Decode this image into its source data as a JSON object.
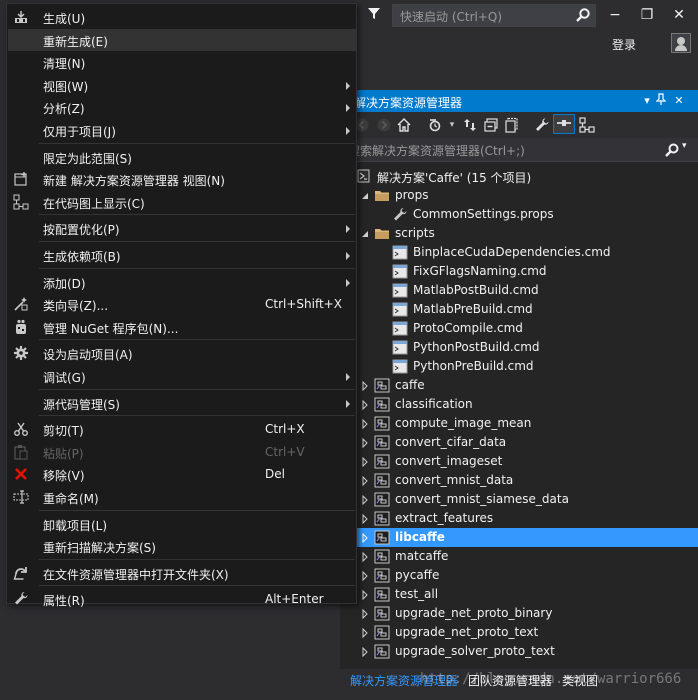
{
  "quick_launch": {
    "placeholder": "快速启动 (Ctrl+Q)"
  },
  "account": {
    "login_label": "登录"
  },
  "window_buttons": {
    "minimize": "−",
    "restore": "❐",
    "close": "✕"
  },
  "solution_explorer": {
    "title": "解决方案资源管理器",
    "search_placeholder": "搜索解决方案资源管理器(Ctrl+;)",
    "tree": [
      {
        "label": "解决方案'Caffe' (15 个项目)",
        "icon": "solution-icon",
        "level": 0,
        "expanded": true
      },
      {
        "label": "props",
        "icon": "folder-icon",
        "level": 1,
        "expanded": true
      },
      {
        "label": "CommonSettings.props",
        "icon": "wrench-icon",
        "level": 2
      },
      {
        "label": "scripts",
        "icon": "folder-icon",
        "level": 1,
        "expanded": true
      },
      {
        "label": "BinplaceCudaDependencies.cmd",
        "icon": "cmd-file-icon",
        "level": 2
      },
      {
        "label": "FixGFlagsNaming.cmd",
        "icon": "cmd-file-icon",
        "level": 2
      },
      {
        "label": "MatlabPostBuild.cmd",
        "icon": "cmd-file-icon",
        "level": 2
      },
      {
        "label": "MatlabPreBuild.cmd",
        "icon": "cmd-file-icon",
        "level": 2
      },
      {
        "label": "ProtoCompile.cmd",
        "icon": "cmd-file-icon",
        "level": 2
      },
      {
        "label": "PythonPostBuild.cmd",
        "icon": "cmd-file-icon",
        "level": 2
      },
      {
        "label": "PythonPreBuild.cmd",
        "icon": "cmd-file-icon",
        "level": 2
      },
      {
        "label": "caffe",
        "icon": "project-icon",
        "level": 1,
        "expanded": false
      },
      {
        "label": "classification",
        "icon": "project-icon",
        "level": 1,
        "expanded": false
      },
      {
        "label": "compute_image_mean",
        "icon": "project-icon",
        "level": 1,
        "expanded": false
      },
      {
        "label": "convert_cifar_data",
        "icon": "project-icon",
        "level": 1,
        "expanded": false
      },
      {
        "label": "convert_imageset",
        "icon": "project-icon",
        "level": 1,
        "expanded": false
      },
      {
        "label": "convert_mnist_data",
        "icon": "project-icon",
        "level": 1,
        "expanded": false
      },
      {
        "label": "convert_mnist_siamese_data",
        "icon": "project-icon",
        "level": 1,
        "expanded": false
      },
      {
        "label": "extract_features",
        "icon": "project-icon",
        "level": 1,
        "expanded": false
      },
      {
        "label": "libcaffe",
        "icon": "project-icon",
        "level": 1,
        "expanded": false,
        "selected": true
      },
      {
        "label": "matcaffe",
        "icon": "project-icon",
        "level": 1,
        "expanded": false
      },
      {
        "label": "pycaffe",
        "icon": "project-icon",
        "level": 1,
        "expanded": false
      },
      {
        "label": "test_all",
        "icon": "project-icon",
        "level": 1,
        "expanded": false
      },
      {
        "label": "upgrade_net_proto_binary",
        "icon": "project-icon",
        "level": 1,
        "expanded": false
      },
      {
        "label": "upgrade_net_proto_text",
        "icon": "project-icon",
        "level": 1,
        "expanded": false
      },
      {
        "label": "upgrade_solver_proto_text",
        "icon": "project-icon",
        "level": 1,
        "expanded": false
      }
    ],
    "tabs": [
      "解决方案资源管理器",
      "团队资源管理器",
      "类视图"
    ]
  },
  "watermark": "http://blog.csdn.net/warrior666",
  "context_menu": {
    "items": [
      {
        "type": "item",
        "label": "生成(U)",
        "icon": "build-icon"
      },
      {
        "type": "item",
        "label": "重新生成(E)",
        "highlighted": true
      },
      {
        "type": "item",
        "label": "清理(N)"
      },
      {
        "type": "item",
        "label": "视图(W)",
        "submenu": true
      },
      {
        "type": "item",
        "label": "分析(Z)",
        "submenu": true
      },
      {
        "type": "item",
        "label": "仅用于项目(J)",
        "submenu": true
      },
      {
        "type": "sep"
      },
      {
        "type": "item",
        "label": "限定为此范围(S)"
      },
      {
        "type": "item",
        "label": "新建 解决方案资源管理器 视图(N)",
        "icon": "new-view-icon"
      },
      {
        "type": "item",
        "label": "在代码图上显示(C)",
        "icon": "code-map-icon"
      },
      {
        "type": "sep"
      },
      {
        "type": "item",
        "label": "按配置优化(P)",
        "submenu": true
      },
      {
        "type": "sep"
      },
      {
        "type": "item",
        "label": "生成依赖项(B)",
        "submenu": true
      },
      {
        "type": "sep"
      },
      {
        "type": "item",
        "label": "添加(D)",
        "submenu": true
      },
      {
        "type": "item",
        "label": "类向导(Z)...",
        "shortcut": "Ctrl+Shift+X",
        "icon": "class-wizard-icon"
      },
      {
        "type": "item",
        "label": "管理 NuGet 程序包(N)...",
        "icon": "nuget-icon"
      },
      {
        "type": "sep"
      },
      {
        "type": "item",
        "label": "设为启动项目(A)",
        "icon": "gear-icon"
      },
      {
        "type": "item",
        "label": "调试(G)",
        "submenu": true
      },
      {
        "type": "sep"
      },
      {
        "type": "item",
        "label": "源代码管理(S)",
        "submenu": true
      },
      {
        "type": "sep"
      },
      {
        "type": "item",
        "label": "剪切(T)",
        "shortcut": "Ctrl+X",
        "icon": "scissors-icon"
      },
      {
        "type": "item",
        "label": "粘贴(P)",
        "shortcut": "Ctrl+V",
        "icon": "paste-icon",
        "disabled": true
      },
      {
        "type": "item",
        "label": "移除(V)",
        "shortcut": "Del",
        "icon": "remove-icon"
      },
      {
        "type": "item",
        "label": "重命名(M)",
        "icon": "rename-icon"
      },
      {
        "type": "sep"
      },
      {
        "type": "item",
        "label": "卸载项目(L)"
      },
      {
        "type": "item",
        "label": "重新扫描解决方案(S)"
      },
      {
        "type": "sep"
      },
      {
        "type": "item",
        "label": "在文件资源管理器中打开文件夹(X)",
        "icon": "open-folder-icon"
      },
      {
        "type": "sep"
      },
      {
        "type": "item",
        "label": "属性(R)",
        "shortcut": "Alt+Enter",
        "icon": "wrench-icon"
      }
    ]
  },
  "colors": {
    "accent": "#007acc",
    "selection": "#3399ff",
    "menu_bg": "#1b1b1c",
    "remove_red": "#e51400"
  }
}
